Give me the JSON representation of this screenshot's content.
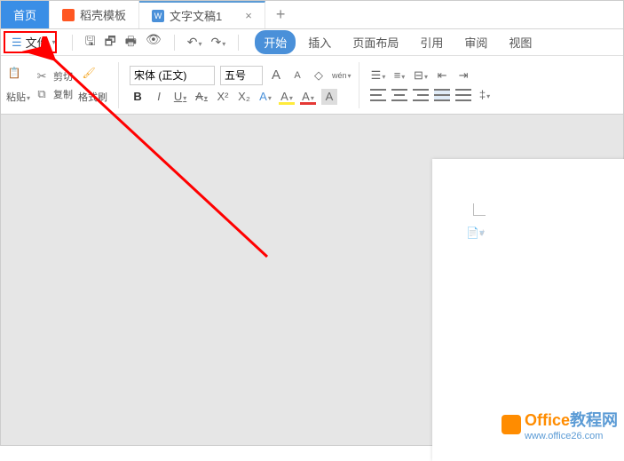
{
  "tabs": {
    "home": "首页",
    "template": "稻壳模板",
    "doc": "文字文稿1",
    "doc_icon": "W",
    "close": "×",
    "plus": "+"
  },
  "qat": {
    "file_label": "文件",
    "undo": "↶",
    "redo": "↷"
  },
  "menu": {
    "start": "开始",
    "insert": "插入",
    "layout": "页面布局",
    "reference": "引用",
    "review": "审阅",
    "view": "视图"
  },
  "ribbon": {
    "paste": "粘贴",
    "cut": "剪切",
    "copy": "复制",
    "format_painter": "格式刷",
    "font_name": "宋体 (正文)",
    "font_size": "五号",
    "bold": "B",
    "italic": "I",
    "underline": "U",
    "strike": "S",
    "font_a": "A",
    "font_a2": "A",
    "highlight": "A",
    "font_color": "A",
    "font_grow": "A",
    "font_shrink": "A",
    "font_clear": "◇",
    "font_phonetic": "wén"
  },
  "chart_data": null,
  "watermark": {
    "title_en": "Office",
    "title_cn": "教程网",
    "url": "www.office26.com"
  }
}
